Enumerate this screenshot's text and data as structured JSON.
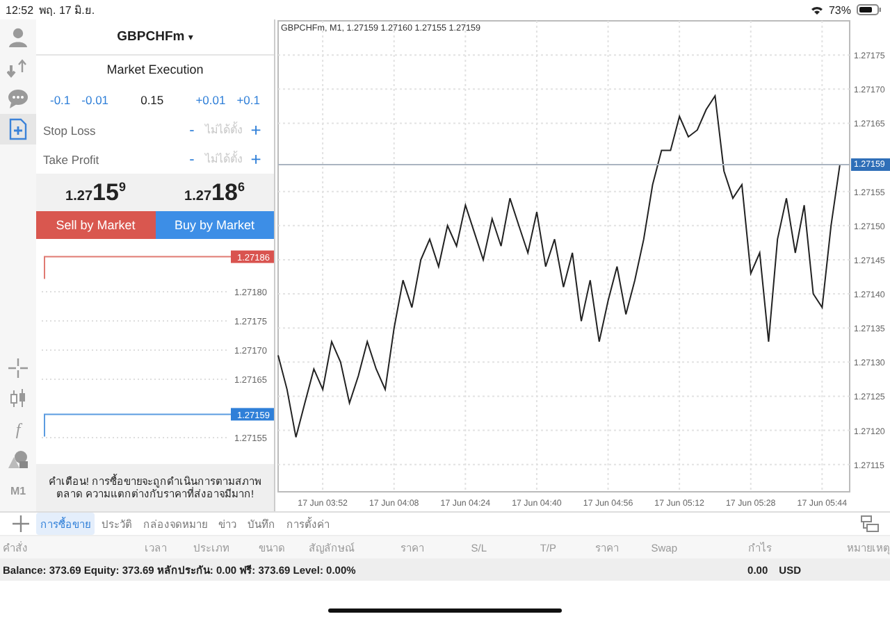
{
  "status_bar": {
    "time": "12:52",
    "date": "พฤ. 17 มิ.ย.",
    "battery": "73%"
  },
  "toolbar": [
    {
      "selected": false
    },
    {
      "selected": false
    },
    {
      "selected": false
    },
    {
      "selected": true
    }
  ],
  "tools": [
    {
      "kind": "icon"
    },
    {
      "kind": "icon"
    },
    {
      "kind": "text",
      "label": "f"
    },
    {
      "kind": "icon"
    },
    {
      "kind": "text",
      "label": "M1"
    }
  ],
  "order": {
    "symbol": "GBPCHFm",
    "caret": "▾",
    "execution": "Market Execution",
    "volume": {
      "steps_down": [
        "-0.1",
        "-0.01"
      ],
      "value": "0.15",
      "steps_up": [
        "+0.01",
        "+0.1"
      ]
    },
    "stops": [
      {
        "label": "Stop Loss",
        "minus": "-",
        "placeholder": "ไม่ได้ตั้ง",
        "plus": "+"
      },
      {
        "label": "Take Profit",
        "minus": "-",
        "placeholder": "ไม่ได้ตั้ง",
        "plus": "+"
      }
    ],
    "prices": [
      {
        "prefix": "1.27",
        "big": "15",
        "last": "9"
      },
      {
        "prefix": "1.27",
        "big": "18",
        "last": "6"
      }
    ],
    "buttons": [
      {
        "kind": "sell",
        "label": "Sell by Market"
      },
      {
        "kind": "buy",
        "label": "Buy by Market"
      }
    ],
    "price_ladder": {
      "ticks": [
        "1.27180",
        "1.27175",
        "1.27170",
        "1.27165",
        "1.27155"
      ],
      "ask": "1.27186",
      "bid": "1.27159"
    },
    "warning": "คำเตือน! การซื้อขายจะถูกดำเนินการตามสภาพตลาด ความแตกต่างกับราคาที่ส่งอาจมีมาก!"
  },
  "chart": {
    "chart_data": {
      "type": "line",
      "title": "GBPCHFm, M1, 1.27159 1.27160 1.27155 1.27159",
      "categories": [
        null,
        null,
        null,
        null,
        null,
        "17 Jun 03:52",
        null,
        null,
        null,
        null,
        null,
        null,
        null,
        "17 Jun 04:08",
        null,
        null,
        null,
        null,
        null,
        null,
        null,
        "17 Jun 04:24",
        null,
        null,
        null,
        null,
        null,
        null,
        null,
        "17 Jun 04:40",
        null,
        null,
        null,
        null,
        null,
        null,
        null,
        "17 Jun 04:56",
        null,
        null,
        null,
        null,
        null,
        null,
        null,
        "17 Jun 05:12",
        null,
        null,
        null,
        null,
        null,
        null,
        null,
        "17 Jun 05:28",
        null,
        null,
        null,
        null,
        null,
        null,
        null,
        "17 Jun 05:44",
        null,
        null
      ],
      "series": [
        {
          "color": "#222222",
          "values": [
            1.27131,
            1.27126,
            1.27119,
            1.27124,
            1.27129,
            1.27126,
            1.27133,
            1.2713,
            1.27124,
            1.27128,
            1.27133,
            1.27129,
            1.27126,
            1.27135,
            1.27142,
            1.27138,
            1.27145,
            1.27148,
            1.27144,
            1.2715,
            1.27147,
            1.27153,
            1.27149,
            1.27145,
            1.27151,
            1.27147,
            1.27154,
            1.2715,
            1.27146,
            1.27152,
            1.27144,
            1.27148,
            1.27141,
            1.27146,
            1.27136,
            1.27142,
            1.27133,
            1.27139,
            1.27144,
            1.27137,
            1.27142,
            1.27148,
            1.27156,
            1.27161,
            1.27161,
            1.27166,
            1.27163,
            1.27164,
            1.27167,
            1.27169,
            1.27158,
            1.27154,
            1.27156,
            1.27143,
            1.27146,
            1.27133,
            1.27148,
            1.27154,
            1.27146,
            1.27153,
            1.2714,
            1.27138,
            1.2715,
            1.27159
          ]
        }
      ],
      "grid": true,
      "ylim": [
        1.27111,
        1.2718
      ],
      "yticks": [
        {
          "value": 1.27115,
          "label": "1.27115"
        },
        {
          "value": 1.2712,
          "label": "1.27120"
        },
        {
          "value": 1.27125,
          "label": "1.27125"
        },
        {
          "value": 1.2713,
          "label": "1.27130"
        },
        {
          "value": 1.27135,
          "label": "1.27135"
        },
        {
          "value": 1.2714,
          "label": "1.27140"
        },
        {
          "value": 1.27145,
          "label": "1.27145"
        },
        {
          "value": 1.2715,
          "label": "1.27150"
        },
        {
          "value": 1.27155,
          "label": "1.27155"
        },
        {
          "value": 1.27165,
          "label": "1.27165"
        },
        {
          "value": 1.2717,
          "label": "1.27170"
        },
        {
          "value": 1.27175,
          "label": "1.27175"
        }
      ]
    },
    "current_price": "1.27159"
  },
  "tabs": [
    {
      "label": "การซื้อขาย",
      "selected": true
    },
    {
      "label": "ประวัติ",
      "selected": false
    },
    {
      "label": "กล่องจดหมาย",
      "selected": false
    },
    {
      "label": "ข่าว",
      "selected": false
    },
    {
      "label": "บันทึก",
      "selected": false
    },
    {
      "label": "การตั้งค่า",
      "selected": false
    }
  ],
  "table": {
    "columns": [
      "คำสั่ง",
      "เวลา",
      "ประเภท",
      "ขนาด",
      "สัญลักษณ์",
      "ราคา",
      "S/L",
      "T/P",
      "ราคา",
      "Swap",
      "กำไร",
      "หมายเหตุ"
    ]
  },
  "summary": {
    "text": "Balance: 373.69 Equity: 373.69 หลักประกัน: 0.00 ฟรี: 373.69 Level: 0.00%",
    "profit": "0.00",
    "currency": "USD"
  }
}
